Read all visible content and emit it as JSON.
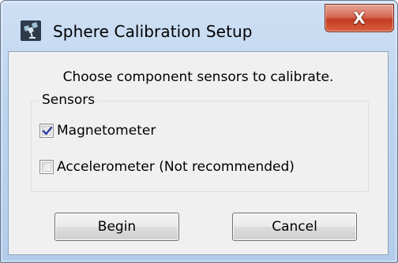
{
  "window": {
    "title": "Sphere Calibration Setup",
    "close_label": "X",
    "app_icon": "satellite-app-icon"
  },
  "content": {
    "instruction": "Choose component sensors to calibrate."
  },
  "sensors": {
    "group_label": "Sensors",
    "options": [
      {
        "label": "Magnetometer",
        "checked": true
      },
      {
        "label": "Accelerometer (Not recommended)",
        "checked": false
      }
    ]
  },
  "buttons": {
    "begin": "Begin",
    "cancel": "Cancel"
  },
  "colors": {
    "titlebar": "#bdd4ef",
    "close_button": "#c23c22",
    "dialog_background": "#f0f0f0",
    "checkmark": "#2b3f9e"
  }
}
